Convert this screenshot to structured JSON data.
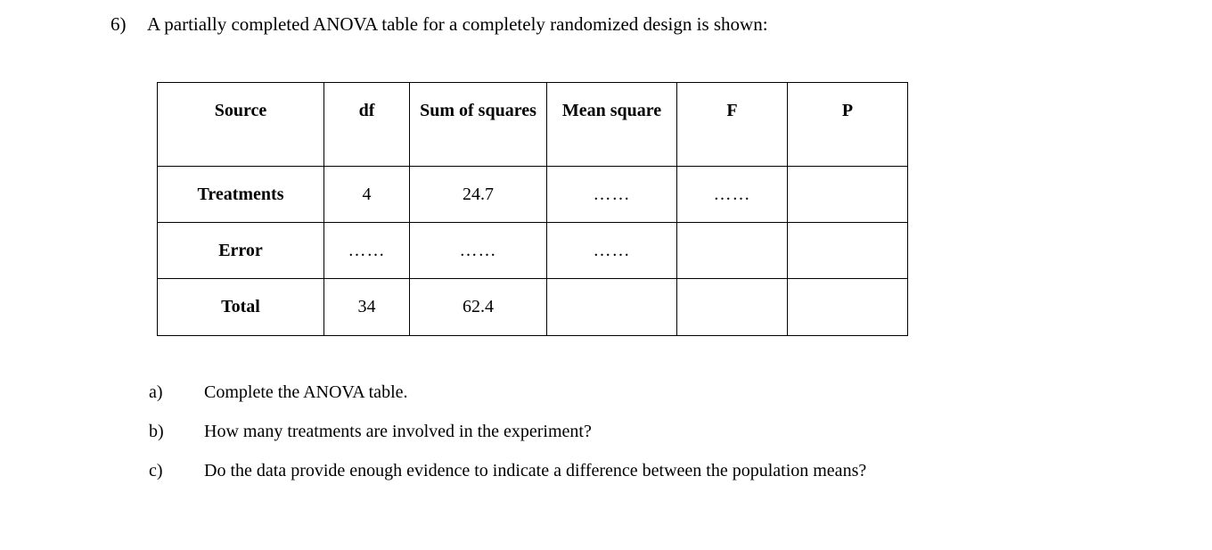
{
  "question": {
    "number": "6)",
    "prompt": "A partially completed ANOVA table for a completely randomized design is shown:"
  },
  "table": {
    "headers": [
      "Source",
      "df",
      "Sum of squares",
      "Mean square",
      "F",
      "P"
    ],
    "rows": [
      {
        "source": "Treatments",
        "df": "4",
        "sum_of_squares": "24.7",
        "mean_square": "……",
        "f": "……",
        "p": ""
      },
      {
        "source": "Error",
        "df": "……",
        "sum_of_squares": "……",
        "mean_square": "……",
        "f": "",
        "p": ""
      },
      {
        "source": "Total",
        "df": "34",
        "sum_of_squares": "62.4",
        "mean_square": "",
        "f": "",
        "p": ""
      }
    ]
  },
  "subquestions": [
    {
      "marker": "a)",
      "text": "Complete the ANOVA table."
    },
    {
      "marker": "b)",
      "text": "How many treatments are involved in the experiment?"
    },
    {
      "marker": "c)",
      "text": "Do the data provide enough evidence to indicate a difference between the population means?"
    }
  ],
  "colors": {
    "page_background": "#ffffff",
    "text": "#000000",
    "table_border": "#000000"
  }
}
